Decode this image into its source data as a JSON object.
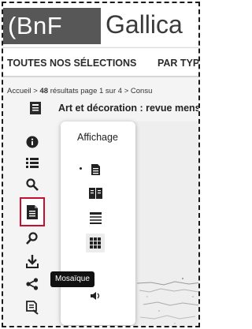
{
  "header": {
    "logo_text": "(BnF",
    "brand_text": "Gallica"
  },
  "nav": {
    "items": [
      {
        "label": "TOUTES NOS SÉLECTIONS"
      },
      {
        "label": "PAR TYPE"
      }
    ]
  },
  "breadcrumb": {
    "home": "Accueil",
    "separator": ">",
    "count": "48",
    "results_text": "résultats page 1 sur 4",
    "next": "Consu"
  },
  "document": {
    "title": "Art et décoration : revue mens"
  },
  "toolbar": {
    "items": [
      {
        "icon": "info-icon"
      },
      {
        "icon": "list-icon"
      },
      {
        "icon": "search-icon"
      },
      {
        "icon": "page-view-icon",
        "active": true
      },
      {
        "icon": "zoom-icon"
      },
      {
        "icon": "download-icon"
      },
      {
        "icon": "share-icon"
      },
      {
        "icon": "cite-icon"
      }
    ]
  },
  "display_menu": {
    "title": "Affichage",
    "options": [
      {
        "icon": "single-page-icon",
        "selected": false
      },
      {
        "icon": "double-page-icon",
        "selected": false
      },
      {
        "icon": "text-mode-icon",
        "selected": false
      },
      {
        "icon": "mosaic-icon",
        "selected": true
      },
      {
        "icon": "audio-icon",
        "selected": false
      }
    ]
  },
  "tooltip": {
    "text": "Mosaïque"
  },
  "colors": {
    "logo_bg": "#575757",
    "active_outline": "#c8102e",
    "tooltip_bg": "#111111"
  }
}
